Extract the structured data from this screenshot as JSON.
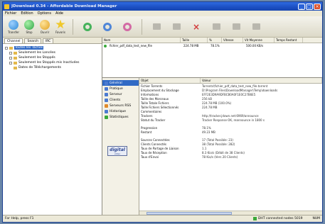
{
  "window": {
    "title": "JDownload 0.34 - Affordable Download Manager"
  },
  "menu": [
    "Fichier",
    "Edition",
    "Options",
    "Aide"
  ],
  "toolbar": {
    "buttons": [
      {
        "label": "Transfer",
        "color": "#2d8ad6"
      },
      {
        "label": "Stop",
        "color": "#2fa646"
      },
      {
        "label": "Ouvrir",
        "color": "#e0a01e"
      },
      {
        "label": "Favoris",
        "color": "#f0c82a"
      }
    ]
  },
  "left_tabs": [
    "Channel",
    "Search",
    "IRC"
  ],
  "tree": [
    {
      "label": "Toutes les Tâches",
      "selected": true
    },
    {
      "label": "Seulement les Lancées",
      "selected": false
    },
    {
      "label": "Seulement les Stoppés",
      "selected": false
    },
    {
      "label": "Seulement les Stoppés mis Inactivées",
      "selected": false
    },
    {
      "label": "Dates de Téléchargements",
      "selected": false
    }
  ],
  "downloads": {
    "columns": [
      "Nom",
      "Taille",
      "%",
      "Vitesse",
      "Vit Moyenne",
      "Temps Restant"
    ],
    "rows": [
      {
        "name": "fichier_pdf_data_test_new_file",
        "size": "224.78 MB",
        "percent": "78.1%",
        "speed": "",
        "avg": "500.00 KB/s",
        "remaining": ""
      }
    ]
  },
  "detail_nav": [
    {
      "label": "Général",
      "active": true
    },
    {
      "label": "Pratique",
      "active": false
    },
    {
      "label": "Serveur",
      "active": false
    },
    {
      "label": "Clients",
      "active": false
    },
    {
      "label": "Serveurs RSS",
      "active": false
    },
    {
      "label": "Historique",
      "active": false
    },
    {
      "label": "Statistiques",
      "active": false
    }
  ],
  "logo": {
    "line1": "digital",
    "line2": "video"
  },
  "props": {
    "columns": [
      "Objet",
      "Valeur"
    ],
    "groups": [
      [
        {
          "k": "Fichier Torrents",
          "v": "Torrents\\fichier_pdf_data_test_new_file.torrent"
        },
        {
          "k": "Emplacement du Stockage",
          "v": "D:\\Program Files\\DownloadManager\\Temp\\downloads"
        },
        {
          "k": "Informations",
          "v": "EFF2E3D9A9DFBCB0A0F1E0C27B6E5"
        },
        {
          "k": "Taille des Morceaux",
          "v": "256 kB"
        },
        {
          "k": "Taille Totale Fichiers",
          "v": "224.78 MB (100.0%)"
        },
        {
          "k": "Taille Fichiers Sélectionnés",
          "v": "224.78 MB"
        },
        {
          "k": "Commentaires",
          "v": ""
        },
        {
          "k": "Trackers",
          "v": "http://tracker.jdown.net:6969/announce"
        },
        {
          "k": "Statut du Tracker",
          "v": "Tracker Response OK, reannounce in 1800 s"
        }
      ],
      [
        {
          "k": "Progression",
          "v": "78.1%"
        },
        {
          "k": "Restant",
          "v": "49.23 MB"
        }
      ],
      [
        {
          "k": "Sources Connectées",
          "v": "17 (Total Possible: 23)"
        },
        {
          "k": "Clients Connectés",
          "v": "38 (Total Possible: 282)"
        },
        {
          "k": "Taux de Partage de Liaison",
          "v": "1.1"
        },
        {
          "k": "Taux de Réception",
          "v": "8.3 Kio/s (Débit de 38 Clients)"
        },
        {
          "k": "Taux d'Envoi",
          "v": "78 Kio/s (Vers 20 Clients)"
        }
      ]
    ]
  },
  "status": {
    "left": "For Help, press F1",
    "middle": "DHT connected nodes 5019",
    "right": "NUM"
  }
}
